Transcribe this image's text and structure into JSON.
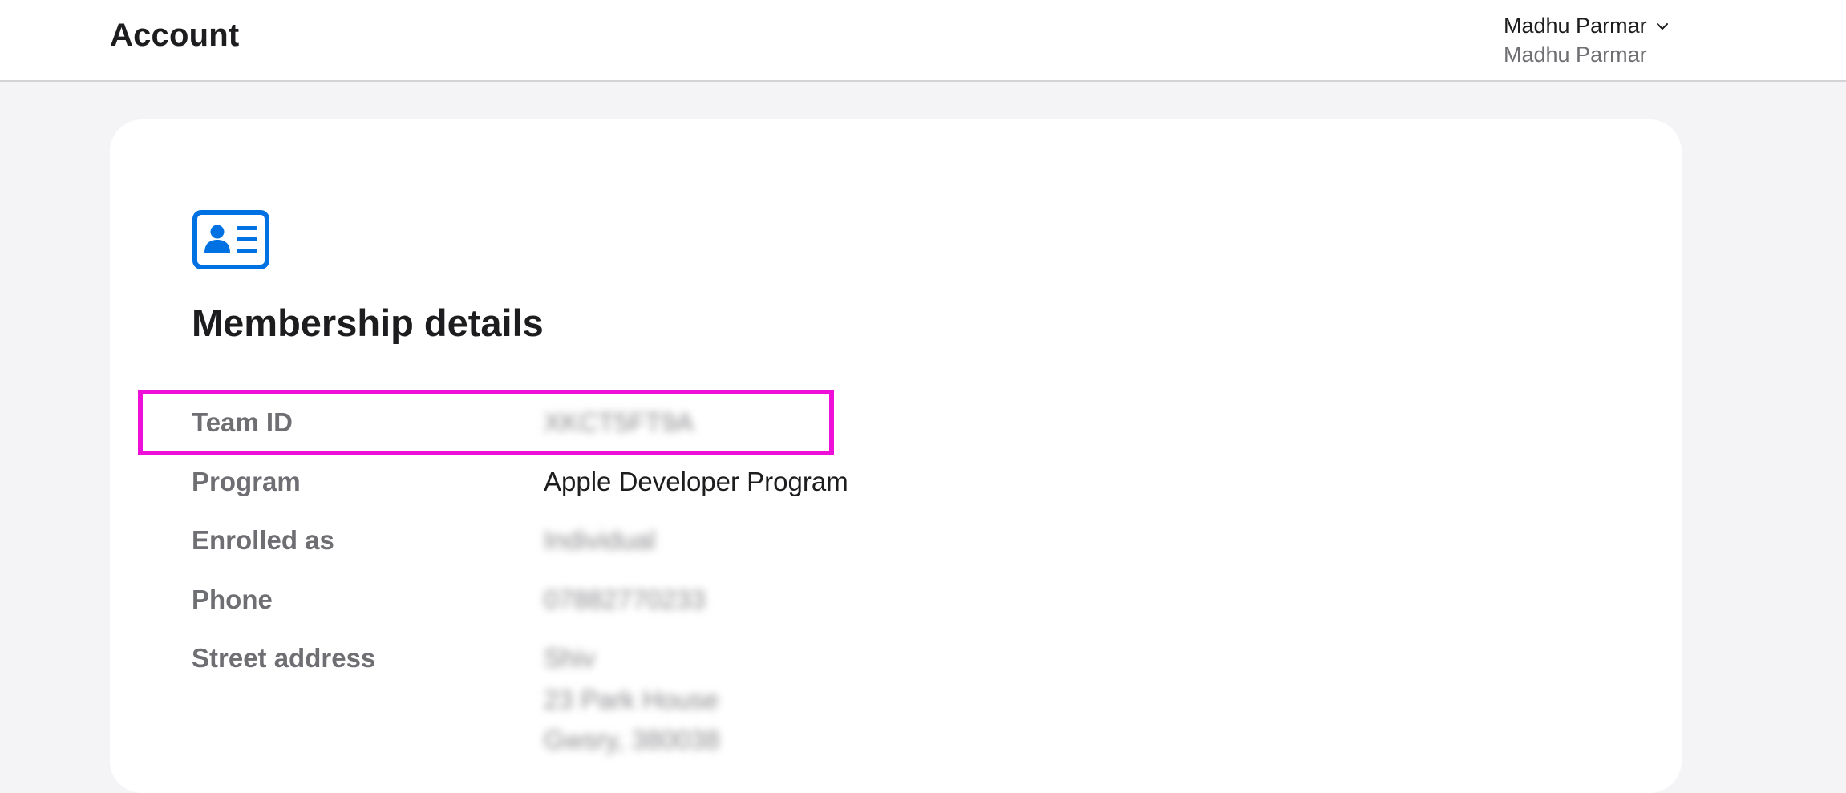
{
  "header": {
    "title": "Account",
    "user_name": "Madhu Parmar",
    "user_sub": "Madhu Parmar"
  },
  "icons": {
    "membership": "id-card-icon",
    "menu": "chevron-down-icon"
  },
  "colors": {
    "accent": "#0071e3",
    "highlight": "#ee10d8",
    "label": "#6e6e73",
    "text": "#1d1d1f"
  },
  "membership": {
    "title": "Membership details",
    "rows": [
      {
        "label": "Team ID",
        "value": "XKCT5FT9A",
        "redacted": true
      },
      {
        "label": "Program",
        "value": "Apple Developer Program",
        "redacted": false
      },
      {
        "label": "Enrolled as",
        "value": "Individual",
        "redacted": true
      },
      {
        "label": "Phone",
        "value": "07882770233",
        "redacted": true
      },
      {
        "label": "Street address",
        "value": "Shiv",
        "redacted": true
      }
    ],
    "address_extra_lines": [
      "23 Park House",
      "Gwsry, 380038"
    ]
  }
}
